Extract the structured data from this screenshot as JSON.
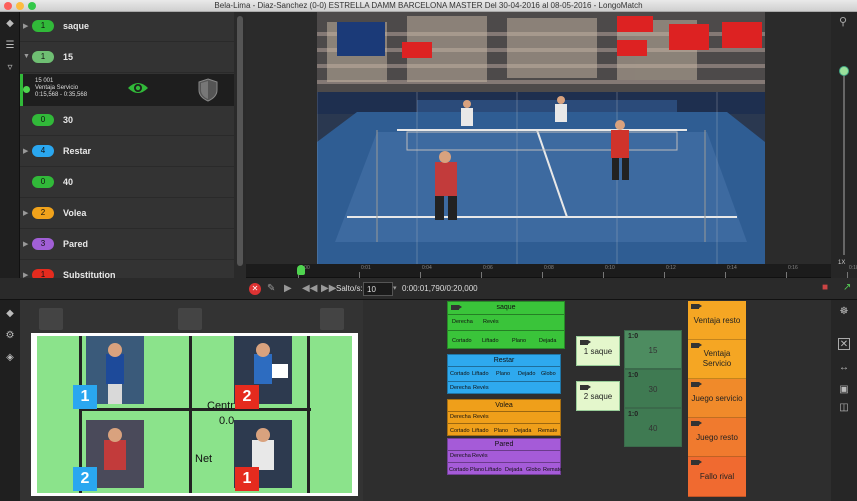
{
  "window": {
    "title": "Bela-Lima - Diaz-Sanchez (0-0) ESTRELLA DAMM BARCELONA MASTER Del 30-04-2016 al 08-05-2016 - LongoMatch"
  },
  "timeline": {
    "rows": [
      {
        "count": "1",
        "name": "saque",
        "color": "#31b939"
      },
      {
        "count": "1",
        "name": "15",
        "color": "#6fbf73"
      },
      {
        "count": "0",
        "name": "30",
        "color": "#31b939"
      },
      {
        "count": "4",
        "name": "Restar",
        "color": "#2aa7f0"
      },
      {
        "count": "0",
        "name": "40",
        "color": "#31b939"
      },
      {
        "count": "2",
        "name": "Volea",
        "color": "#f0a21b"
      },
      {
        "count": "3",
        "name": "Pared",
        "color": "#a15fd6"
      },
      {
        "count": "1",
        "name": "Substitution",
        "color": "#e52b1e"
      }
    ],
    "selected_event": {
      "line1": "15 001",
      "line2": "Ventaja Servicio",
      "line3": "0:15,568 - 0:35,568"
    }
  },
  "ruler": {
    "labels": [
      "0:00",
      "0:01",
      "0:04",
      "0:06",
      "0:08",
      "0:10",
      "0:12",
      "0:14",
      "0:16",
      "0:18"
    ]
  },
  "zoom": {
    "label": "1X"
  },
  "controls": {
    "salto_label": "Salto/s:",
    "salto_value": "10",
    "timecode": "0:00:01,790/0:20,000"
  },
  "lineup": {
    "players": [
      {
        "number": "1",
        "color": "#2aa7f0"
      },
      {
        "number": "2",
        "color": "#e52b1e"
      },
      {
        "number": "2",
        "color": "#2aa7f0"
      },
      {
        "number": "1",
        "color": "#e52b1e"
      }
    ],
    "labels": {
      "centre": "Centr",
      "centre_value": "0.0",
      "net": "Net"
    }
  },
  "categories": [
    {
      "title": "saque",
      "color": "#3ac43a",
      "subs": [
        "Derecha",
        "Revés",
        "Cortado",
        "Liftado",
        "Plano",
        "Dejada"
      ]
    },
    {
      "title": "Restar",
      "color": "#2ea9ee",
      "subs": [
        "Cortado",
        "Liftado",
        "Plano",
        "Dejado",
        "Globo",
        "Derecha",
        "Revés"
      ]
    },
    {
      "title": "Volea",
      "color": "#ef9f1a",
      "subs": [
        "Derecha",
        "Revés",
        "Cortado",
        "Liftado",
        "Plano",
        "Dejada",
        "Remate"
      ]
    },
    {
      "title": "Pared",
      "color": "#a55bd8",
      "subs": [
        "Derecha",
        "Revés",
        "Cortado",
        "Plano",
        "Liftado",
        "Dejada",
        "Globo",
        "Remate"
      ]
    }
  ],
  "tags": [
    {
      "label": "1 saque"
    },
    {
      "label": "2 saque"
    }
  ],
  "scores": [
    {
      "key": "1:0",
      "value": "15",
      "color": "#4d8c60"
    },
    {
      "key": "1:0",
      "value": "30",
      "color": "#3f7a52"
    },
    {
      "key": "1:0",
      "value": "40",
      "color": "#3f7a52"
    }
  ],
  "outcomes": [
    {
      "label": "Ventaja resto",
      "color": "#f5a623"
    },
    {
      "label": "Ventaja Servicio",
      "color": "#f5a623"
    },
    {
      "label": "Juego servicio",
      "color": "#f08a2a"
    },
    {
      "label": "Juego resto",
      "color": "#f07a2e"
    },
    {
      "label": "Fallo rival",
      "color": "#f06a30"
    }
  ]
}
